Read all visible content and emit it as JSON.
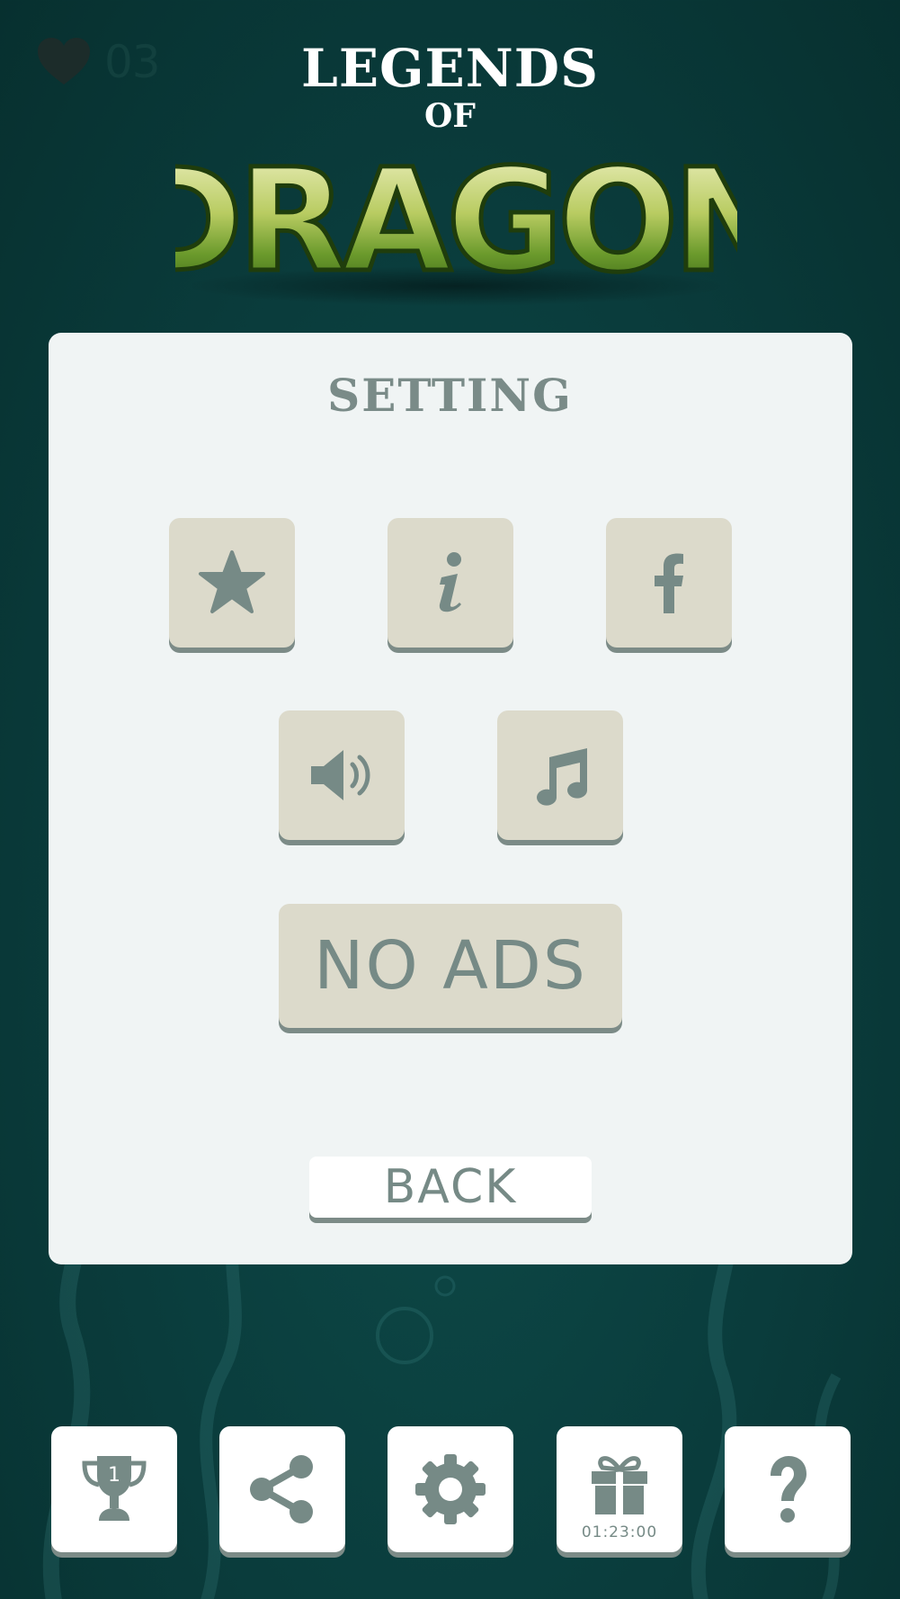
{
  "lives": {
    "count": "03",
    "icon": "heart-icon"
  },
  "logo": {
    "line1": "LEGENDS",
    "line2": "OF",
    "line3": "DRAGON"
  },
  "settings": {
    "title": "SETTING",
    "buttons": [
      {
        "icon": "star-icon"
      },
      {
        "icon": "info-icon"
      },
      {
        "icon": "facebook-icon"
      },
      {
        "icon": "speaker-icon"
      },
      {
        "icon": "music-note-icon"
      }
    ],
    "no_ads_label": "NO ADS",
    "back_label": "BACK"
  },
  "bottom_bar": {
    "items": [
      {
        "icon": "trophy-icon",
        "badge": "1"
      },
      {
        "icon": "share-icon"
      },
      {
        "icon": "gear-icon"
      },
      {
        "icon": "gift-icon",
        "timer": "01:23:00"
      },
      {
        "icon": "question-icon"
      }
    ]
  },
  "colors": {
    "background": "#0a3c3c",
    "panel": "#f0f4f4",
    "tile": "#dcdacb",
    "icon": "#768a86",
    "dragon_green": "#6b9a2c"
  }
}
